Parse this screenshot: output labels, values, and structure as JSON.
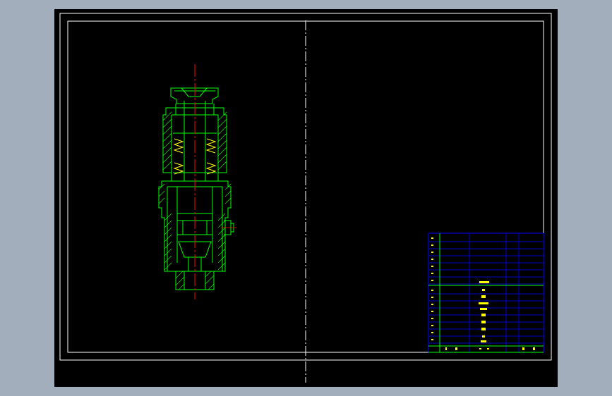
{
  "colors": {
    "background": "#a3aebc",
    "canvas": "#000000",
    "frame": "#ffffff",
    "part_outline": "#00ff00",
    "centerline": "#ff0000",
    "spring": "#ffff00",
    "title_block_grid": "#0000ff",
    "title_block_border": "#00ff00",
    "title_block_text": "#ffff00"
  },
  "title_block": {
    "labels": [
      "设计",
      "审核",
      "工艺",
      "标准化",
      "批准",
      "日期"
    ],
    "bottom_labels": [
      "共",
      "张",
      "第",
      "张"
    ]
  }
}
